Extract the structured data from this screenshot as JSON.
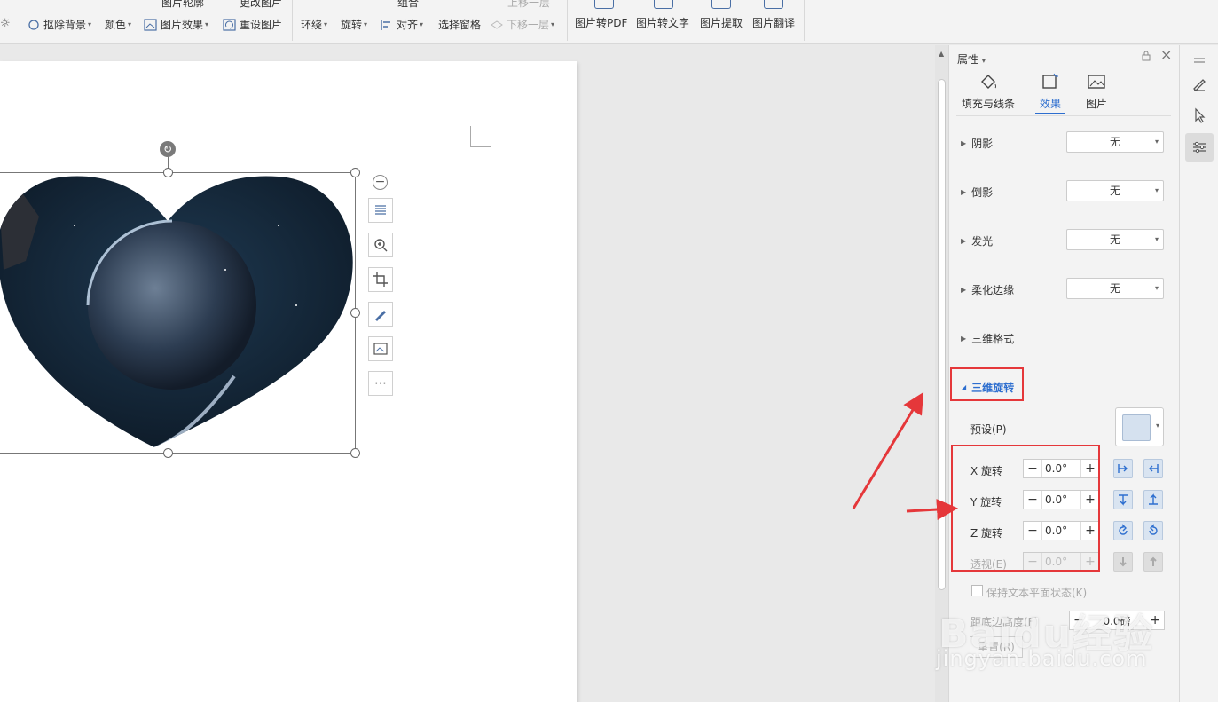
{
  "ribbon": {
    "top_cut_labels": [
      "图片轮廓",
      "更改图片",
      "组合",
      "上移一层"
    ],
    "remove_bg": "抠除背景",
    "color": "颜色",
    "pic_effect": "图片效果",
    "reset_pic": "重设图片",
    "wrap": "环绕",
    "rotate": "旋转",
    "align": "对齐",
    "selection_pane": "选择窗格",
    "send_backward": "下移一层",
    "to_pdf": "图片转PDF",
    "to_text": "图片转文字",
    "extract": "图片提取",
    "translate": "图片翻译"
  },
  "panel": {
    "title": "属性",
    "tabs": [
      {
        "label": "填充与线条"
      },
      {
        "label": "效果"
      },
      {
        "label": "图片"
      }
    ],
    "sections": {
      "shadow": "阴影",
      "reflection": "倒影",
      "glow": "发光",
      "soft_edges": "柔化边缘",
      "format_3d": "三维格式",
      "rotation_3d": "三维旋转"
    },
    "dropdown_none": "无",
    "preset_label": "预设(P)",
    "x_label": "X 旋转",
    "y_label": "Y 旋转",
    "z_label": "Z 旋转",
    "perspective_label": "透视(E)",
    "x_value": "0.0°",
    "y_value": "0.0°",
    "z_value": "0.0°",
    "perspective_value": "0.0°",
    "keep_text_flat": "保持文本平面状态(K)",
    "depth_label": "距底边高度(F)",
    "depth_value": "0.0磅",
    "reset": "重置(R)"
  },
  "watermark": {
    "brand": "Baidu经验",
    "url": "jingyan.baidu.com"
  },
  "colors": {
    "accent": "#2d6ecf",
    "highlight_red": "#e5373a"
  }
}
